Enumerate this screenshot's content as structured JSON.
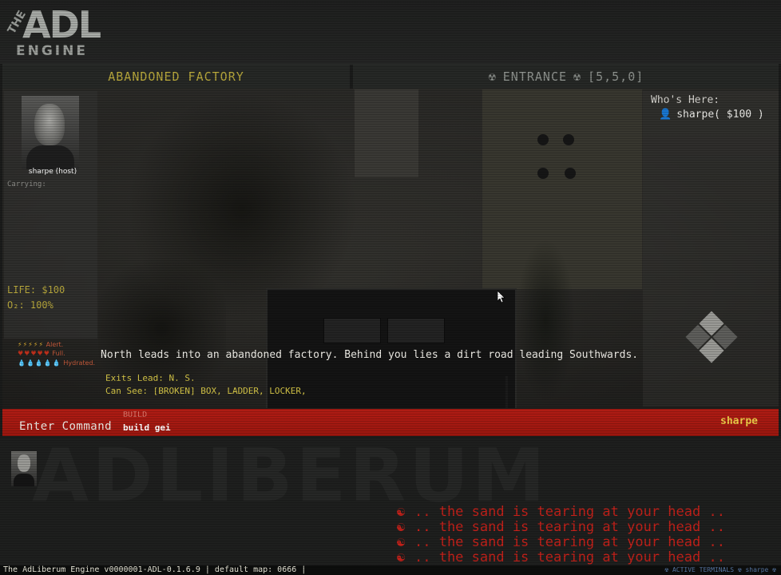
{
  "logo": {
    "the": "THE",
    "adl": "ADL",
    "engine": "ENGINE"
  },
  "location": {
    "name": "ABANDONED FACTORY",
    "room": "ENTRANCE",
    "coords": "[5,5,0]",
    "room_icon": "radiation-icon"
  },
  "player": {
    "name": "sharpe (host)",
    "carrying_label": "Carrying:",
    "life": "LIFE: $100",
    "o2": "O₂: 100%",
    "indicators": [
      {
        "icons": "⚡⚡⚡⚡⚡",
        "label": "Alert.",
        "color": "#e0b030",
        "label_color": "#c85a3a"
      },
      {
        "icons": "♥♥♥♥♥",
        "label": "Full.",
        "color": "#c0301c",
        "label_color": "#c85a3a"
      },
      {
        "icons": "💧💧💧💧💧",
        "label": "Hydrated.",
        "color": "#3a8ad0",
        "label_color": "#c85a3a"
      }
    ]
  },
  "whos_here": {
    "label": "Who's Here:",
    "users": [
      "sharpe( $100 )"
    ]
  },
  "scene": {
    "description": "North leads into an abandoned factory. Behind you lies a dirt road leading Southwards.",
    "exits": "Exits Lead: N. S.",
    "can_see": "Can See: [BROKEN] BOX, LADDER, LOCKER,"
  },
  "command": {
    "label": "Enter Command",
    "hint": "BUILD",
    "value": "build gei",
    "user": "sharpe"
  },
  "messages": [
    ".. the sand is tearing at your head ..",
    ".. the sand is tearing at your head ..",
    ".. the sand is tearing at your head ..",
    ".. the sand is tearing at your head .."
  ],
  "watermark": "ADLIBERUM",
  "status": {
    "left": "The AdLiberum Engine v0000001-ADL-0.1.6.9 | default map: 0666 |",
    "right": "☢ ACTIVE TERMINALS ☢ sharpe ☢"
  },
  "colors": {
    "accent_yellow": "#b8a83c",
    "command_red": "#b01c14",
    "message_red": "#c4211a"
  }
}
